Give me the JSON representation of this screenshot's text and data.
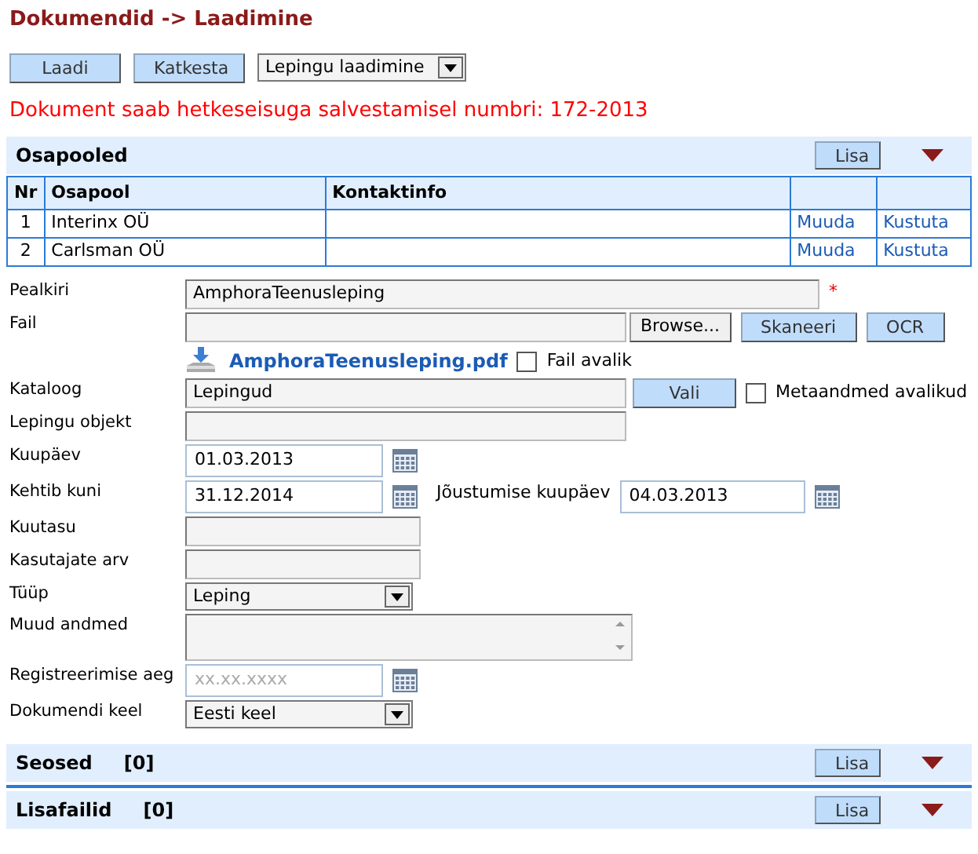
{
  "page_title": "Dokumendid -> Laadimine",
  "toolbar": {
    "buttons": [
      "Laadi",
      "Katkesta"
    ],
    "template_select": "Lepingu laadimine"
  },
  "notice": "Dokument saab hetkeseisuga salvestamisel numbri: 172-2013",
  "parties": {
    "title": "Osapooled",
    "add_button": "Lisa",
    "expanded": true,
    "columns": [
      "Nr",
      "Osapool",
      "Kontaktinfo"
    ],
    "rows": [
      {
        "nr": "1",
        "party": "Interinx OÜ",
        "edit": "Muuda",
        "delete": "Kustuta"
      },
      {
        "nr": "2",
        "party": "Carlsman OÜ",
        "edit": "Muuda",
        "delete": "Kustuta"
      }
    ]
  },
  "form": [
    {
      "kind": "wide_text",
      "label": "Pealkiri",
      "value": "AmphoraTeenusleping",
      "required_mark": "*"
    },
    {
      "kind": "file",
      "label": "Fail",
      "buttons": [
        "Browse...",
        "Skaneeri",
        "OCR"
      ],
      "attachment": "AmphoraTeenusleping.pdf",
      "checkbox_label": "Fail avalik",
      "checked": false
    },
    {
      "kind": "text",
      "label": "Kataloog",
      "value": "Lepingud",
      "button": "Vali",
      "checkbox_label": "Metaandmed avalikud",
      "checked": false
    },
    {
      "kind": "text",
      "label": "Lepingu objekt"
    },
    {
      "kind": "date",
      "label": "Kuupäev",
      "value": "01.03.2013"
    },
    {
      "kind": "date",
      "label": "Kehtib kuni",
      "value": "31.12.2014",
      "side_label": "Jõustumise kuupäev",
      "side_value": "04.03.2013"
    },
    {
      "kind": "short_text",
      "label": "Kuutasu"
    },
    {
      "kind": "short_text",
      "label": "Kasutajate arv"
    },
    {
      "kind": "select",
      "label": "Tüüp",
      "value": "Leping"
    },
    {
      "kind": "textarea",
      "label": "Muud andmed"
    },
    {
      "kind": "date",
      "label": "Registreerimise aeg",
      "placeholder": "xx.xx.xxxx"
    },
    {
      "kind": "select",
      "label": "Dokumendi keel",
      "value": "Eesti keel"
    }
  ],
  "sections": [
    {
      "title": "Seosed",
      "count": "[0]",
      "add_button": "Lisa",
      "expanded": true
    },
    {
      "title": "Lisafailid",
      "count": "[0]",
      "add_button": "Lisa",
      "expanded": true
    }
  ]
}
